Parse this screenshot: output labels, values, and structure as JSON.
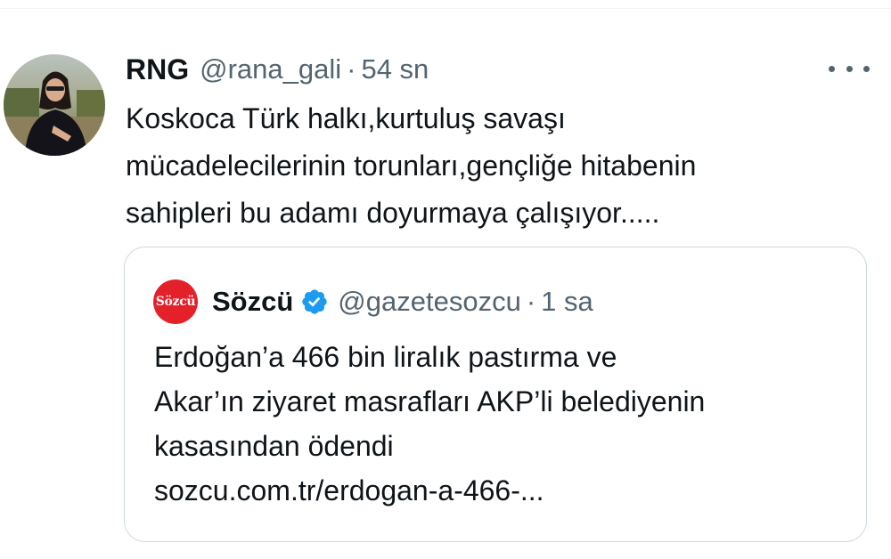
{
  "tweet": {
    "display_name": "RNG",
    "handle": "@rana_gali",
    "separator": "·",
    "timestamp": "54 sn",
    "text_lines": [
      "Koskoca Türk halkı,kurtuluş savaşı",
      "mücadelecilerinin torunları,gençliğe hitabenin",
      "sahipleri bu adamı doyurmaya çalışıyor....."
    ],
    "more_icon": "more-horizontal-icon"
  },
  "quoted_tweet": {
    "avatar_text": "Sözcü",
    "display_name": "Sözcü",
    "verified_icon": "verified-badge-icon",
    "handle": "@gazetesozcu",
    "separator": "·",
    "timestamp": "1 sa",
    "text_lines": [
      "Erdoğan’a 466 bin liralık pastırma ve",
      "Akar’ın ziyaret masrafları AKP’li belediyenin",
      "kasasından ödendi"
    ],
    "link": "sozcu.com.tr/erdogan-a-466-..."
  },
  "colors": {
    "text_primary": "#0f1419",
    "text_secondary": "#536471",
    "border": "#cfd9de",
    "verified_blue": "#1d9bf0",
    "sozcu_red": "#e4202a"
  }
}
